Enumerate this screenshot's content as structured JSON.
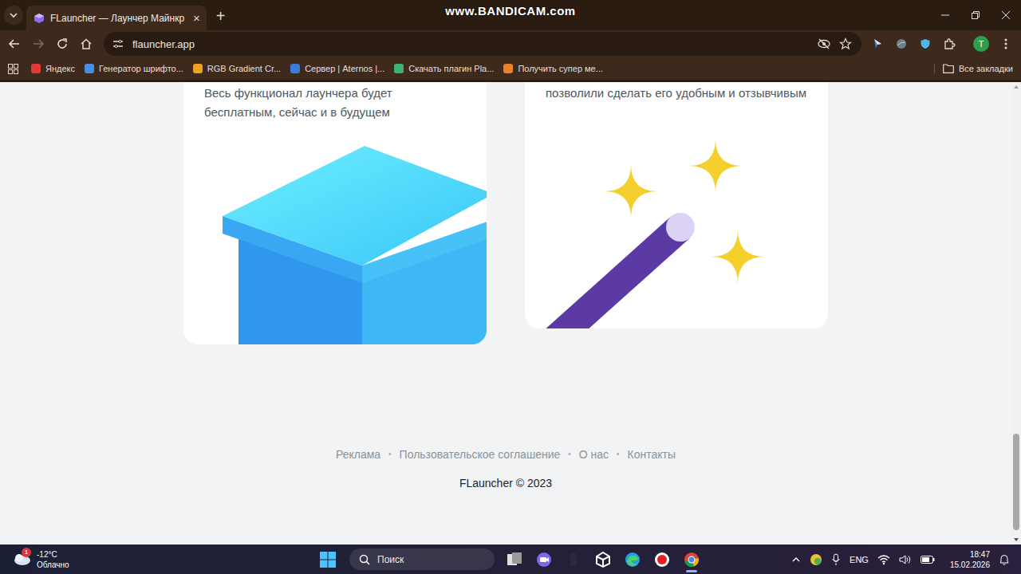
{
  "watermark": "www.BANDICAM.com",
  "browser": {
    "tabs": [
      {
        "title": "FLauncher — Лаунчер Майнкр",
        "close": "×",
        "selected": true
      }
    ],
    "new_tab": "+",
    "forward_disabled": true,
    "address": "flauncher.app",
    "profile": "T",
    "bookmarks": [
      {
        "label": "Яндекс",
        "color": "#e53935"
      },
      {
        "label": "Генератор шрифто...",
        "color": "#4a90e2"
      },
      {
        "label": "RGB Gradient Cr...",
        "color": "#f0a020"
      },
      {
        "label": "Сервер | Aternos |...",
        "color": "#3d7bd9"
      },
      {
        "label": "Скачать плагин Pla...",
        "color": "#3cb371"
      },
      {
        "label": "Получить супер ме...",
        "color": "#e8832a"
      }
    ],
    "all_bookmarks": "Все закладки"
  },
  "page": {
    "cards": [
      {
        "text": "Весь функционал лаунчера будет бесплатным, сейчас и в будущем",
        "kind": "box"
      },
      {
        "text": "позволили сделать его удобным и отзывчивым",
        "kind": "wand"
      }
    ],
    "footer_links": [
      "Реклама",
      "Пользовательское соглашение",
      "О нас",
      "Контакты"
    ],
    "separator": "•",
    "copyright": "FLauncher © 2023"
  },
  "scrollbar": {
    "level": 0.22,
    "at_end": true
  },
  "taskbar": {
    "weather": {
      "temp": "-12°C",
      "desc": "Облачно",
      "badge": "1"
    },
    "search": "Поиск",
    "apps": [
      {
        "kind": "taskview",
        "selected": false
      },
      {
        "kind": "meet",
        "selected": false
      },
      {
        "kind": "blank",
        "selected": false
      },
      {
        "kind": "unity",
        "selected": false
      },
      {
        "kind": "edge",
        "selected": false
      },
      {
        "kind": "bandicam",
        "selected": false
      },
      {
        "kind": "chrome",
        "selected": true
      }
    ],
    "language": "ENG",
    "time": "18:47",
    "date": "15.02.2026"
  }
}
